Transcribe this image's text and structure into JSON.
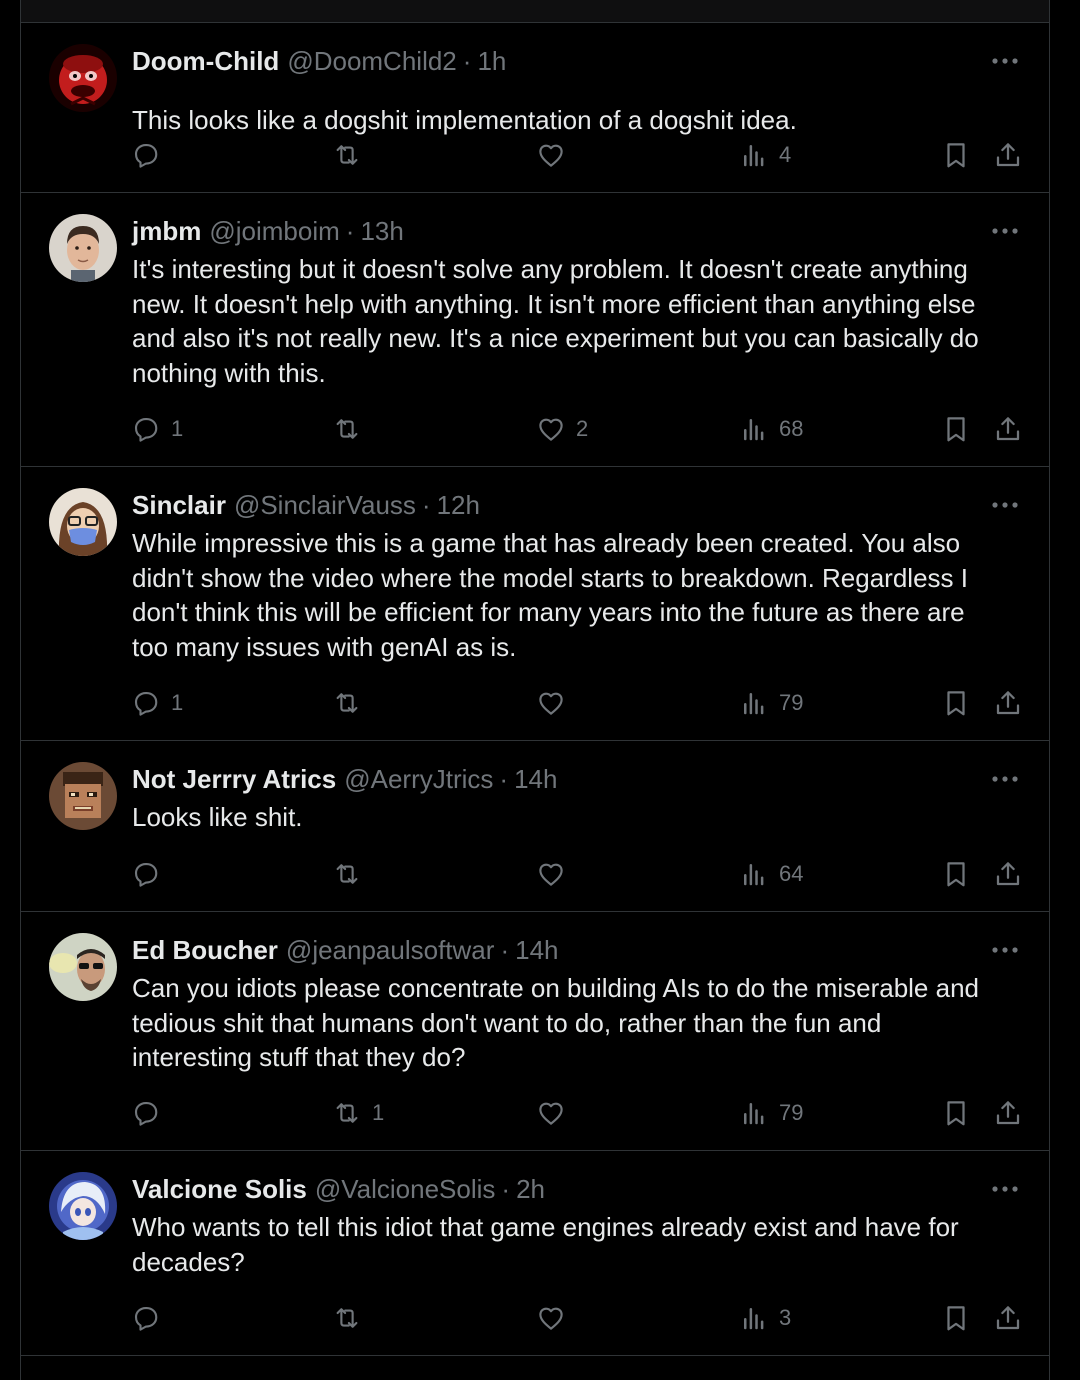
{
  "colors": {
    "background": "#000000",
    "text": "#e7e9ea",
    "muted": "#71767b",
    "divider": "#2f3336"
  },
  "tweets": [
    {
      "name": "Doom-Child",
      "handle": "@DoomChild2",
      "sep": "·",
      "time": "1h",
      "lines": [
        "This looks like a dogshit implementation of a dogshit idea."
      ],
      "replies": "",
      "retweets": "",
      "likes": "",
      "views": "4",
      "avatar": "red-cartoon-face"
    },
    {
      "name": "jmbm",
      "handle": "@joimboim",
      "sep": "·",
      "time": "13h",
      "lines": [
        "It's interesting but it doesn't solve any problem. It doesn't create anything",
        "new. It doesn't help with anything. It isn't more efficient than anything else",
        "and also it's not really new. It's a nice experiment but you can basically do",
        "nothing with this."
      ],
      "replies": "1",
      "retweets": "",
      "likes": "2",
      "views": "68",
      "avatar": "man-photo"
    },
    {
      "name": "Sinclair",
      "handle": "@SinclairVauss",
      "sep": "·",
      "time": "12h",
      "lines": [
        "While impressive this is a game that has already been created. You also",
        "didn't show the video where the model starts to breakdown. Regardless I",
        "don't think this will be efficient for many years into the future as there are",
        "too many issues with genAI as is."
      ],
      "replies": "1",
      "retweets": "",
      "likes": "",
      "views": "79",
      "avatar": "masked-cartoon"
    },
    {
      "name": "Not Jerrry Atrics",
      "handle": "@AerryJtrics",
      "sep": "·",
      "time": "14h",
      "lines": [
        "Looks like shit."
      ],
      "replies": "",
      "retweets": "",
      "likes": "",
      "views": "64",
      "avatar": "pixel-face"
    },
    {
      "name": "Ed Boucher",
      "handle": "@jeanpaulsoftwar",
      "sep": "·",
      "time": "14h",
      "lines": [
        "Can you idiots please concentrate on building AIs to do the miserable and",
        "tedious shit that humans don't want to do, rather than the fun and",
        "interesting stuff that they do?"
      ],
      "replies": "",
      "retweets": "1",
      "likes": "",
      "views": "79",
      "avatar": "sunglasses-man"
    },
    {
      "name": "Valcione Solis",
      "handle": "@ValcioneSolis",
      "sep": "·",
      "time": "2h",
      "lines": [
        "Who wants to tell this idiot that game engines already exist and have for",
        "decades?"
      ],
      "replies": "",
      "retweets": "",
      "likes": "",
      "views": "3",
      "avatar": "anime-character"
    }
  ]
}
